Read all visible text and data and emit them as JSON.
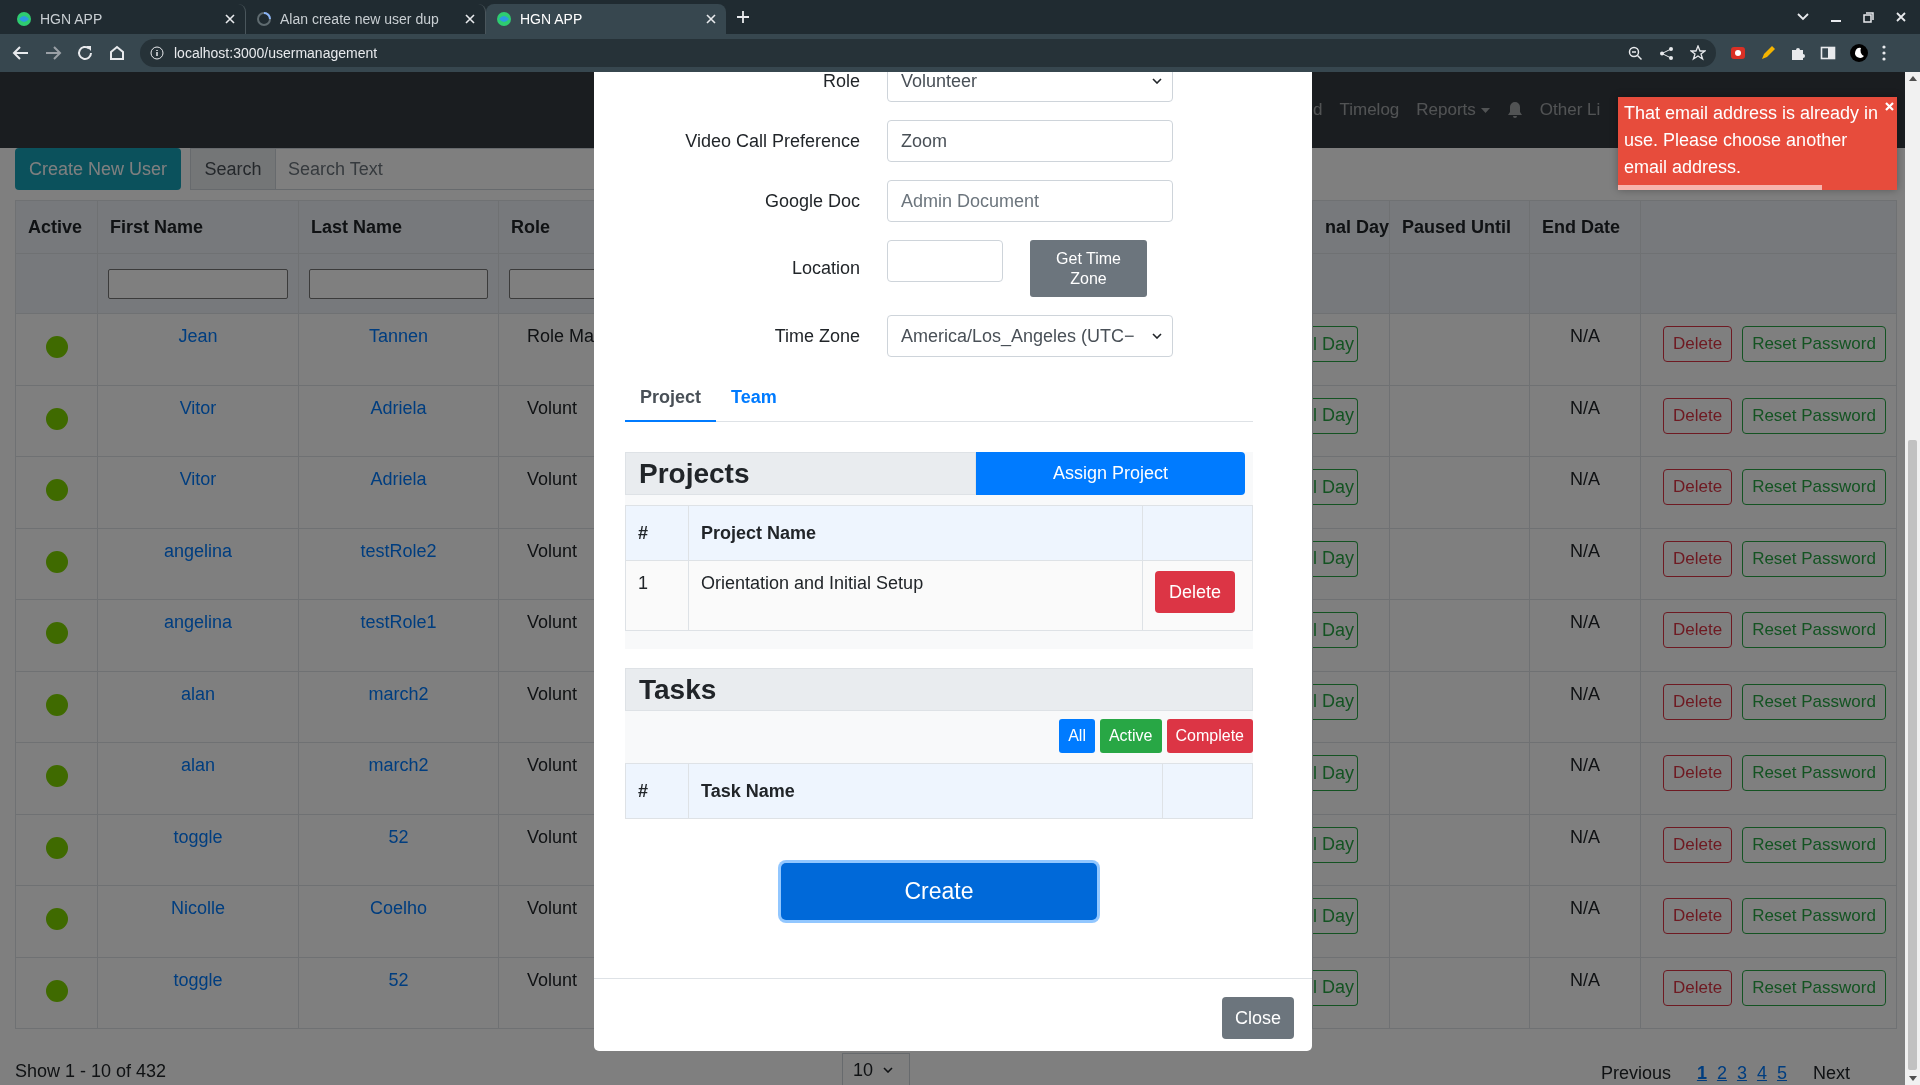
{
  "browser": {
    "tabs": [
      {
        "title": "HGN APP",
        "selected": false,
        "kind": "app"
      },
      {
        "title": "Alan create new user dup",
        "selected": false,
        "kind": "repo"
      },
      {
        "title": "HGN APP",
        "selected": true,
        "kind": "app"
      }
    ],
    "url": "localhost:3000/usermanagement"
  },
  "navbar": {
    "items": [
      {
        "kind": "link",
        "label": "d"
      },
      {
        "kind": "link",
        "label": "Timelog"
      },
      {
        "kind": "dropdown",
        "label": "Reports"
      },
      {
        "kind": "bell"
      },
      {
        "kind": "link",
        "label": "Other Li"
      }
    ]
  },
  "toolbar": {
    "create_button": "Create New User",
    "search_label": "Search",
    "search_placeholder": "Search Text"
  },
  "table": {
    "columns": [
      {
        "label": "Active",
        "filter": false
      },
      {
        "label": "First Name",
        "filter": true
      },
      {
        "label": "Last Name",
        "filter": true
      },
      {
        "label": "Role",
        "filter": true
      },
      {
        "label": "nal Day",
        "filter": false
      },
      {
        "label": "Paused Until",
        "filter": false
      },
      {
        "label": "End Date",
        "filter": false
      }
    ],
    "rows": [
      {
        "active": true,
        "first_name": "Jean",
        "last_name": "Tannen",
        "role": "Role Ma",
        "final_day": "l Day",
        "end_date": "N/A",
        "delete": "Delete",
        "reset": "Reset Password"
      },
      {
        "active": true,
        "first_name": "Vitor",
        "last_name": "Adriela",
        "role": "Volunt",
        "final_day": "l Day",
        "end_date": "N/A",
        "delete": "Delete",
        "reset": "Reset Password"
      },
      {
        "active": true,
        "first_name": "Vitor",
        "last_name": "Adriela",
        "role": "Volunt",
        "final_day": "l Day",
        "end_date": "N/A",
        "delete": "Delete",
        "reset": "Reset Password"
      },
      {
        "active": true,
        "first_name": "angelina",
        "last_name": "testRole2",
        "role": "Volunt",
        "final_day": "l Day",
        "end_date": "N/A",
        "delete": "Delete",
        "reset": "Reset Password"
      },
      {
        "active": true,
        "first_name": "angelina",
        "last_name": "testRole1",
        "role": "Volunt",
        "final_day": "l Day",
        "end_date": "N/A",
        "delete": "Delete",
        "reset": "Reset Password"
      },
      {
        "active": true,
        "first_name": "alan",
        "last_name": "march2",
        "role": "Volunt",
        "final_day": "l Day",
        "end_date": "N/A",
        "delete": "Delete",
        "reset": "Reset Password"
      },
      {
        "active": true,
        "first_name": "alan",
        "last_name": "march2",
        "role": "Volunt",
        "final_day": "l Day",
        "end_date": "N/A",
        "delete": "Delete",
        "reset": "Reset Password"
      },
      {
        "active": true,
        "first_name": "toggle",
        "last_name": "52",
        "role": "Volunt",
        "final_day": "l Day",
        "end_date": "N/A",
        "delete": "Delete",
        "reset": "Reset Password"
      },
      {
        "active": true,
        "first_name": "Nicolle",
        "last_name": "Coelho",
        "role": "Volunt",
        "final_day": "l Day",
        "end_date": "N/A",
        "delete": "Delete",
        "reset": "Reset Password"
      },
      {
        "active": true,
        "first_name": "toggle",
        "last_name": "52",
        "role": "Volunt",
        "final_day": "l Day",
        "end_date": "N/A",
        "delete": "Delete",
        "reset": "Reset Password"
      }
    ]
  },
  "footer": {
    "summary": "Show 1 - 10 of 432",
    "page_size": "10",
    "previous": "Previous",
    "pages": [
      {
        "label": "1",
        "selected": true
      },
      {
        "label": "2",
        "selected": false
      },
      {
        "label": "3",
        "selected": false
      },
      {
        "label": "4",
        "selected": false
      },
      {
        "label": "5",
        "selected": false
      }
    ],
    "next": "Next"
  },
  "modal": {
    "fields": [
      {
        "kind": "select",
        "label": "Role",
        "value": "Volunteer"
      },
      {
        "kind": "input",
        "label": "Video Call Preference",
        "value": "Zoom"
      },
      {
        "kind": "input",
        "label": "Google Doc",
        "placeholder": "Admin Document"
      },
      {
        "kind": "location",
        "label": "Location",
        "button": "Get Time Zone"
      },
      {
        "kind": "select",
        "label": "Time Zone",
        "value": "America/Los_Angeles (UTC−"
      }
    ],
    "tabs": [
      {
        "label": "Project",
        "selected": true
      },
      {
        "label": "Team",
        "selected": false
      }
    ],
    "projects": {
      "title": "Projects",
      "assign_button": "Assign Project",
      "columns": [
        "#",
        "Project Name"
      ],
      "rows": [
        {
          "index": "1",
          "name": "Orientation and Initial Setup",
          "delete": "Delete"
        }
      ]
    },
    "tasks": {
      "title": "Tasks",
      "filters": [
        {
          "kind": "all",
          "label": "All"
        },
        {
          "kind": "active",
          "label": "Active"
        },
        {
          "kind": "complete",
          "label": "Complete"
        }
      ],
      "columns": [
        "#",
        "Task Name"
      ]
    },
    "create_button": "Create",
    "close_button": "Close"
  },
  "toast": {
    "message": "That email address is already in use. Please choose another email address.",
    "level": 0.73
  }
}
